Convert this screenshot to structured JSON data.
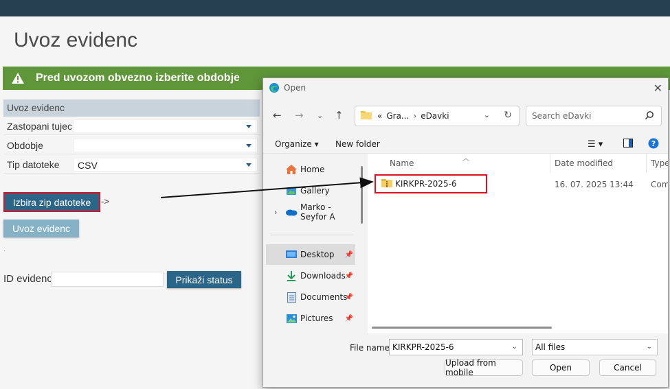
{
  "page": {
    "title": "Uvoz evidenc",
    "alert_text": "Pred uvozom obvezno izberite obdobje",
    "panel_header": "Uvoz evidenc",
    "fields": [
      {
        "label": "Zastopani tujec",
        "value": ""
      },
      {
        "label": "Obdobje",
        "value": ""
      },
      {
        "label": "Tip datoteke",
        "value": "CSV"
      }
    ],
    "zip_button": "Izbira zip datoteke",
    "zip_arrow_text": "->",
    "import_button": "Uvoz evidenc",
    "id_label": "ID evidenc",
    "id_value": "",
    "status_button": "Prikaži status"
  },
  "colors": {
    "topbar": "#27404f",
    "alert_green": "#5f963a",
    "primary_button": "#2b6688",
    "disabled_button": "#86b2c6",
    "highlight_red": "#e01020"
  },
  "dialog": {
    "title": "Open",
    "close_icon": "close-icon",
    "nav": {
      "back": "back-arrow-icon",
      "forward": "forward-arrow-icon",
      "recent": "chevron-down-icon",
      "up": "up-arrow-icon"
    },
    "address": {
      "prefix": "«",
      "crumb1": "Gra...",
      "separator": "›",
      "crumb2": "eDavki"
    },
    "search_placeholder": "Search eDavki",
    "organize": "Organize",
    "new_folder": "New folder",
    "sidebar": [
      {
        "label": "Home",
        "icon": "home-icon",
        "pinned": false,
        "selected": false
      },
      {
        "label": "Gallery",
        "icon": "gallery-icon",
        "pinned": false,
        "selected": false
      },
      {
        "label": "Marko - Seyfor A",
        "icon": "onedrive-cloud-icon",
        "pinned": false,
        "selected": false
      },
      {
        "label": "Desktop",
        "icon": "desktop-icon",
        "pinned": true,
        "selected": true
      },
      {
        "label": "Downloads",
        "icon": "download-icon",
        "pinned": true,
        "selected": false
      },
      {
        "label": "Documents",
        "icon": "documents-icon",
        "pinned": true,
        "selected": false
      },
      {
        "label": "Pictures",
        "icon": "pictures-icon",
        "pinned": true,
        "selected": false
      }
    ],
    "columns": [
      "Name",
      "Date modified",
      "Type"
    ],
    "files": [
      {
        "name": "KIRKPR-2025-6",
        "date": "16. 07. 2025 13:44",
        "type": "Com"
      }
    ],
    "file_name_label": "File name:",
    "file_name_value": "KIRKPR-2025-6",
    "file_type": "All files",
    "upload_mobile": "Upload from mobile",
    "open_button": "Open",
    "cancel_button": "Cancel"
  }
}
